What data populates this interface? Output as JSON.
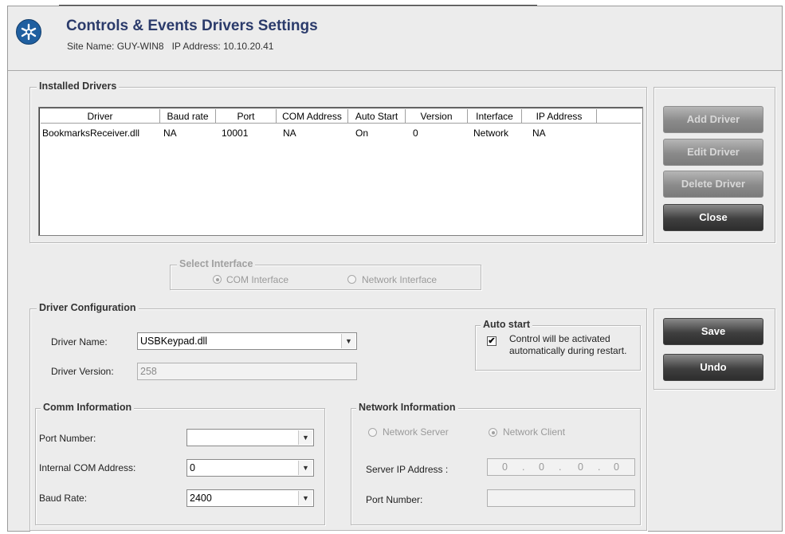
{
  "header": {
    "title": "Controls & Events Drivers Settings",
    "site": "Site Name: GUY-WIN8",
    "ip": "IP Address: 10.10.20.41"
  },
  "installed": {
    "legend": "Installed Drivers",
    "columns": [
      "Driver",
      "Baud rate",
      "Port",
      "COM Address",
      "Auto Start",
      "Version",
      "Interface",
      "IP Address"
    ],
    "rows": [
      [
        "BookmarksReceiver.dll",
        "NA",
        "10001",
        "NA",
        "On",
        "0",
        "Network",
        "NA"
      ]
    ]
  },
  "buttons": {
    "add": "Add Driver",
    "edit": "Edit Driver",
    "delete": "Delete Driver",
    "close": "Close",
    "save": "Save",
    "undo": "Undo"
  },
  "select_interface": {
    "legend": "Select Interface",
    "com": "COM Interface",
    "network": "Network Interface"
  },
  "driver_config": {
    "legend": "Driver Configuration",
    "name_label": "Driver Name:",
    "name_value": "USBKeypad.dll",
    "version_label": "Driver Version:",
    "version_value": "258"
  },
  "auto_start": {
    "legend": "Auto start",
    "text1": "Control will be activated",
    "text2": "automatically during restart.",
    "checked": true
  },
  "comm": {
    "legend": "Comm Information",
    "port_label": "Port Number:",
    "port_value": "",
    "com_label": "Internal COM Address:",
    "com_value": "0",
    "baud_label": "Baud Rate:",
    "baud_value": "2400"
  },
  "network": {
    "legend": "Network Information",
    "server": "Network Server",
    "client": "Network Client",
    "ip_label": "Server IP Address :",
    "ip_parts": [
      "0",
      "0",
      "0",
      "0"
    ],
    "port_label": "Port Number:",
    "port_value": ""
  }
}
